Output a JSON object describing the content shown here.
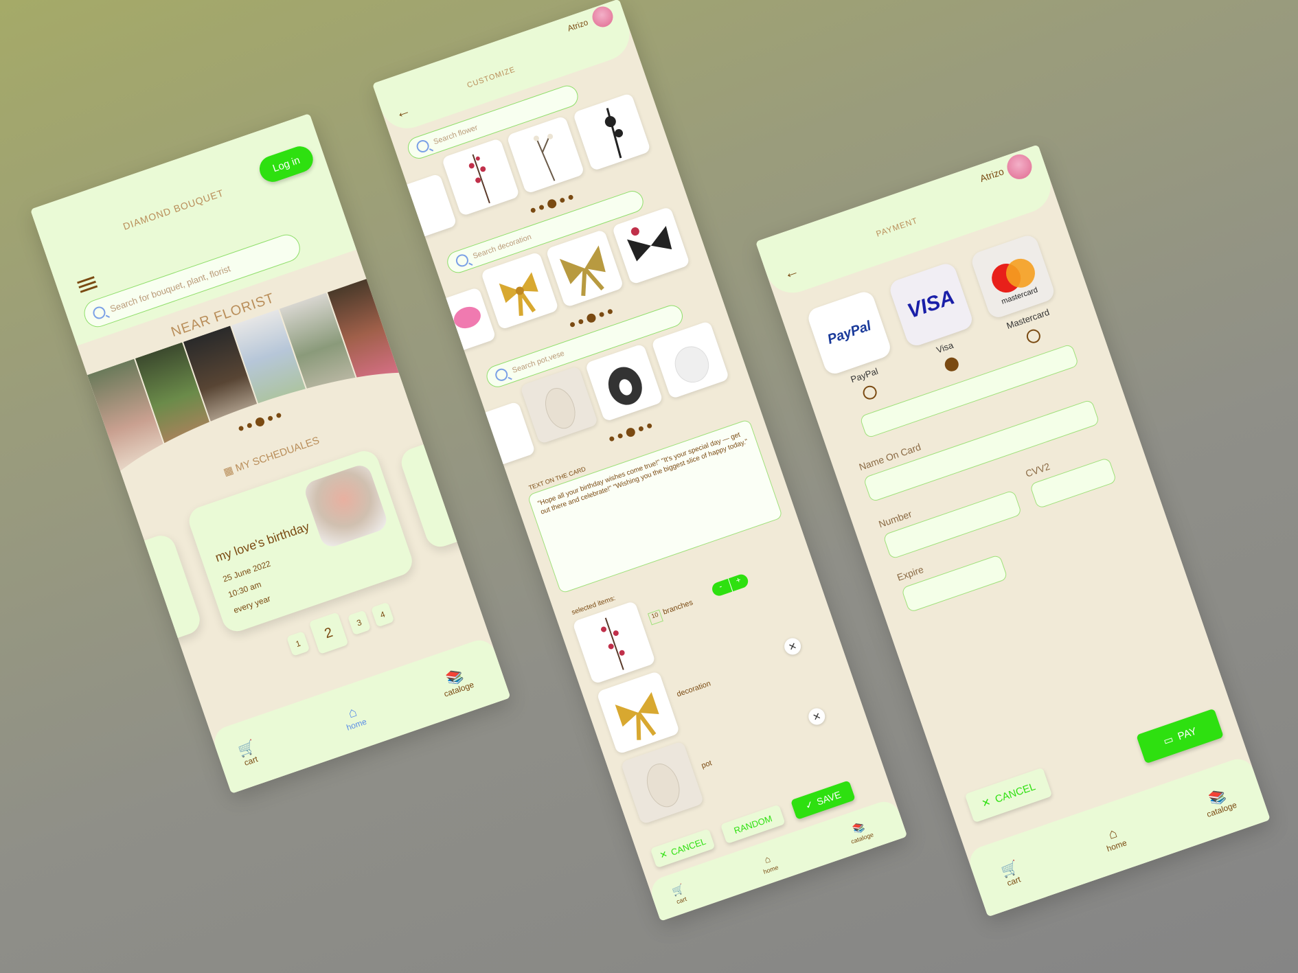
{
  "home": {
    "brand": "DIAMOND BOUQUET",
    "login": "Log in",
    "search_placeholder": "Search for bouquet, plant, florist",
    "near_title": "NEAR FLORIST",
    "schedules_title": "MY SCHEDUALES",
    "card": {
      "title": "my love's birthday",
      "date": "25 June 2022",
      "time": "10:30 am",
      "repeat": "every year"
    },
    "pages": [
      "1",
      "2",
      "3",
      "4"
    ],
    "nav": {
      "cart": "cart",
      "home": "home",
      "catalog": "cataloge"
    }
  },
  "customize": {
    "title": "CUSTOMIZE",
    "user": "Atrizo",
    "search_flower": "Search flower",
    "search_decoration": "Search decoration",
    "search_pot": "Search pot,vese",
    "card_label": "TEXT ON THE CARD",
    "card_text": "\"Hope all your birthday wishes come true!\" \"It's your special day — get out there and celebrate!\" \"Wishing you the biggest slice of happy today.\"",
    "selected_label": "selected items:",
    "branches_count": "10",
    "branches_label": "branches",
    "minus": "-",
    "plus": "+",
    "decoration_label": "decoration",
    "pot_label": "pot",
    "cancel": "CANCEL",
    "random": "RANDOM",
    "save": "SAVE",
    "nav": {
      "cart": "cart",
      "home": "home",
      "catalog": "cataloge"
    }
  },
  "payment": {
    "title": "PAYMENT",
    "user": "Atrizo",
    "methods": [
      {
        "label": "PayPal",
        "logo": "PayPal",
        "selected": false
      },
      {
        "label": "Visa",
        "logo": "VISA",
        "selected": true
      },
      {
        "label": "Mastercard",
        "logo": "mastercard",
        "selected": false
      }
    ],
    "name_label": "Name On Card",
    "number_label": "Number",
    "cvv_label": "CVV2",
    "expire_label": "Expire",
    "pay": "PAY",
    "cancel": "CANCEL",
    "nav": {
      "cart": "cart",
      "home": "home",
      "catalog": "cataloge"
    }
  },
  "colors": {
    "accent": "#2ee010",
    "brown": "#7a4a12",
    "panel": "#eafad6",
    "bg": "#f1ead7"
  }
}
